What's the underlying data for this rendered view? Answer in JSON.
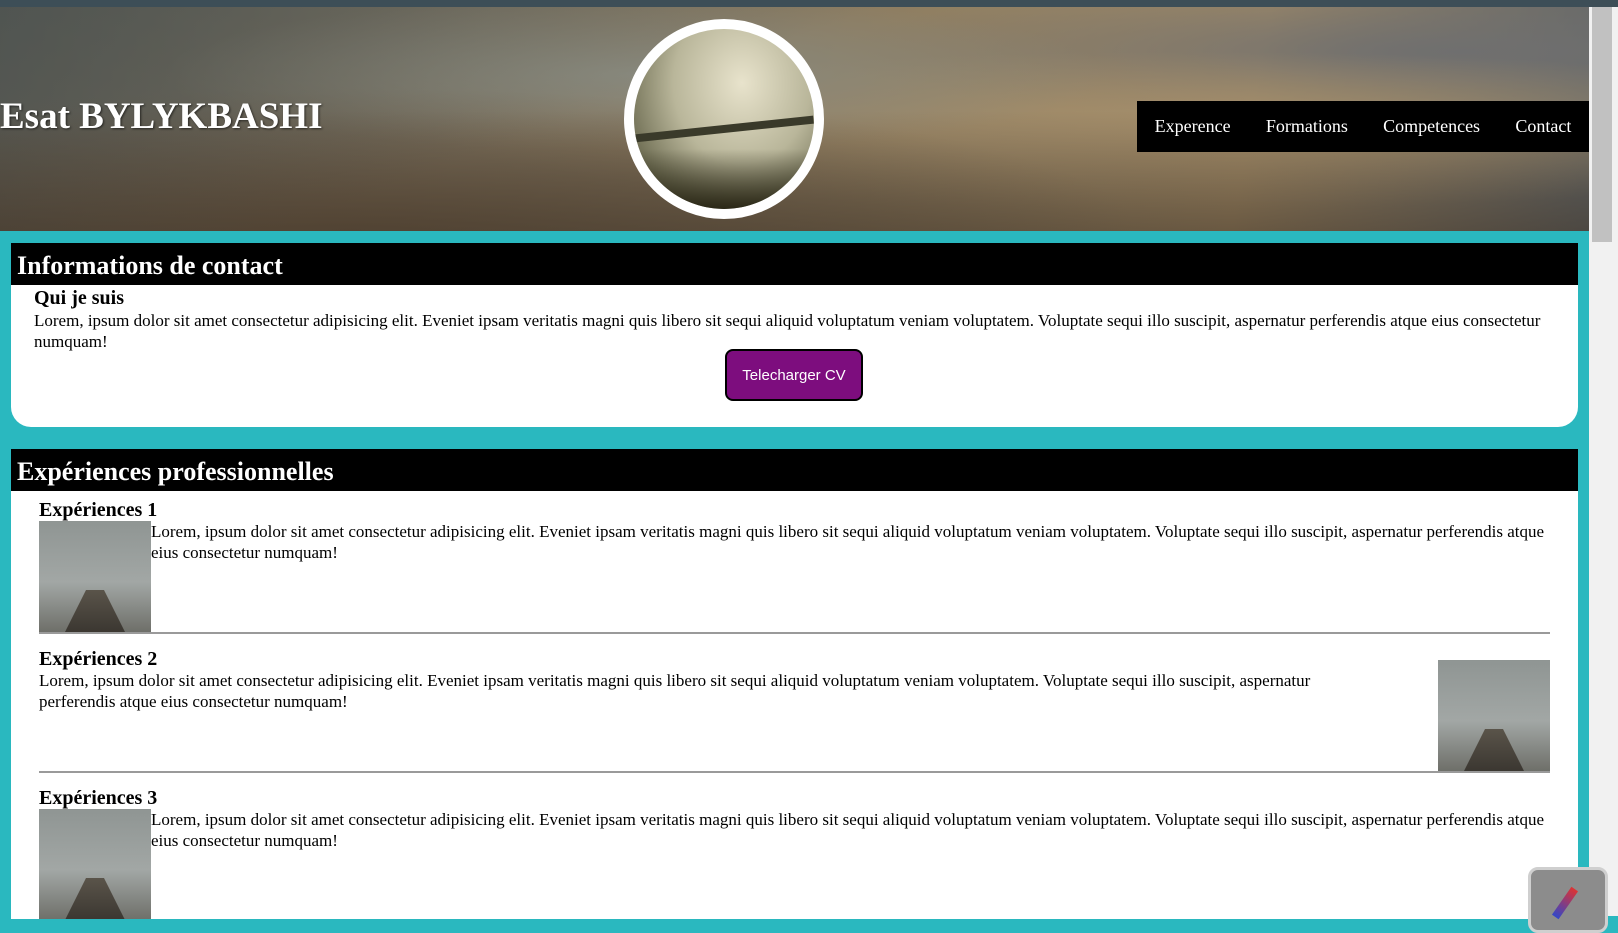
{
  "header": {
    "site_title": "Esat BYLYKBASHI",
    "nav": [
      "Experence",
      "Formations",
      "Competences",
      "Contact"
    ]
  },
  "contact": {
    "heading": "Informations de contact",
    "subheading": "Qui je suis",
    "text": "Lorem, ipsum dolor sit amet consectetur adipisicing elit. Eveniet ipsam veritatis magni quis libero sit sequi aliquid voluptatum veniam voluptatem. Voluptate sequi illo suscipit, aspernatur perferendis atque eius consectetur numquam!",
    "cv_button": "Telecharger CV"
  },
  "experiences": {
    "heading": "Expériences professionnelles",
    "items": [
      {
        "title": "Expériences 1",
        "text": "Lorem, ipsum dolor sit amet consectetur adipisicing elit. Eveniet ipsam veritatis magni quis libero sit sequi aliquid voluptatum veniam voluptatem. Voluptate sequi illo suscipit, aspernatur perferendis atque eius consectetur numquam!"
      },
      {
        "title": "Expériences 2",
        "text": "Lorem, ipsum dolor sit amet consectetur adipisicing elit. Eveniet ipsam veritatis magni quis libero sit sequi aliquid voluptatum veniam voluptatem. Voluptate sequi illo suscipit, aspernatur perferendis atque eius consectetur numquam!"
      },
      {
        "title": "Expériences 3",
        "text": "Lorem, ipsum dolor sit amet consectetur adipisicing elit. Eveniet ipsam veritatis magni quis libero sit sequi aliquid voluptatum veniam voluptatem. Voluptate sequi illo suscipit, aspernatur perferendis atque eius consectetur numquam!"
      }
    ]
  },
  "colors": {
    "page_background": "#2ab8bf",
    "cv_button": "#7d0d7e",
    "section_header": "#000000",
    "nav_background": "#000000"
  },
  "icons": [
    "pen-icon"
  ]
}
